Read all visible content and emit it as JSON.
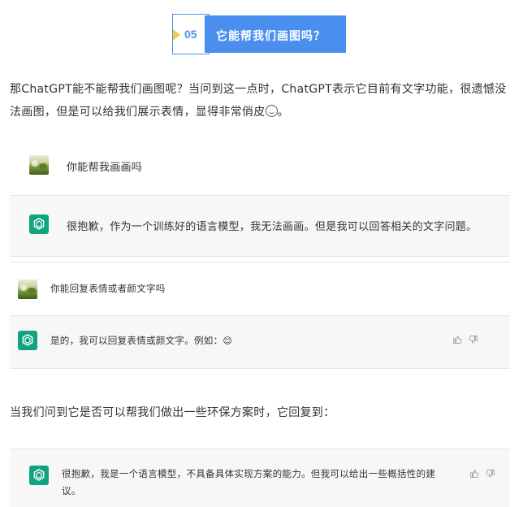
{
  "section": {
    "number": "05",
    "title": "它能帮我们画图吗？",
    "colors": {
      "accent": "#4a8ff0",
      "marker": "#f7c94a"
    }
  },
  "paragraphs": {
    "intro": "那ChatGPT能不能帮我们画图呢？当问到这一点时，ChatGPT表示它目前有文字功能，很遗憾没法画图，但是可以给我们展示表情，显得非常俏皮",
    "intro_end": "。",
    "followup": "当我们问到它是否可以帮我们做出一些环保方案时，它回复到："
  },
  "chat1": {
    "user_text": "你能帮我画画吗",
    "bot_text": "很抱歉，作为一个训练好的语言模型，我无法画画。但是我可以回答相关的文字问题。"
  },
  "chat2": {
    "user_text": "你能回复表情或者颜文字吗",
    "bot_text": "是的，我可以回复表情或颜文字。例如：",
    "emoji": "😊"
  },
  "chat3": {
    "bot_text_line1": "很抱歉，我是一个语言模型，不具备具体实现方案的能力。但我可以给出一些概括性的建",
    "bot_text_line2": "议。"
  },
  "icons": {
    "user_avatar": "photo-avatar",
    "bot_avatar": "openai-logo-icon",
    "like": "thumbs-up-icon",
    "dislike": "thumbs-down-icon"
  },
  "colors": {
    "chat_bg": "#f7f7f8",
    "gpt_green": "#10a37f",
    "text": "#333333"
  }
}
